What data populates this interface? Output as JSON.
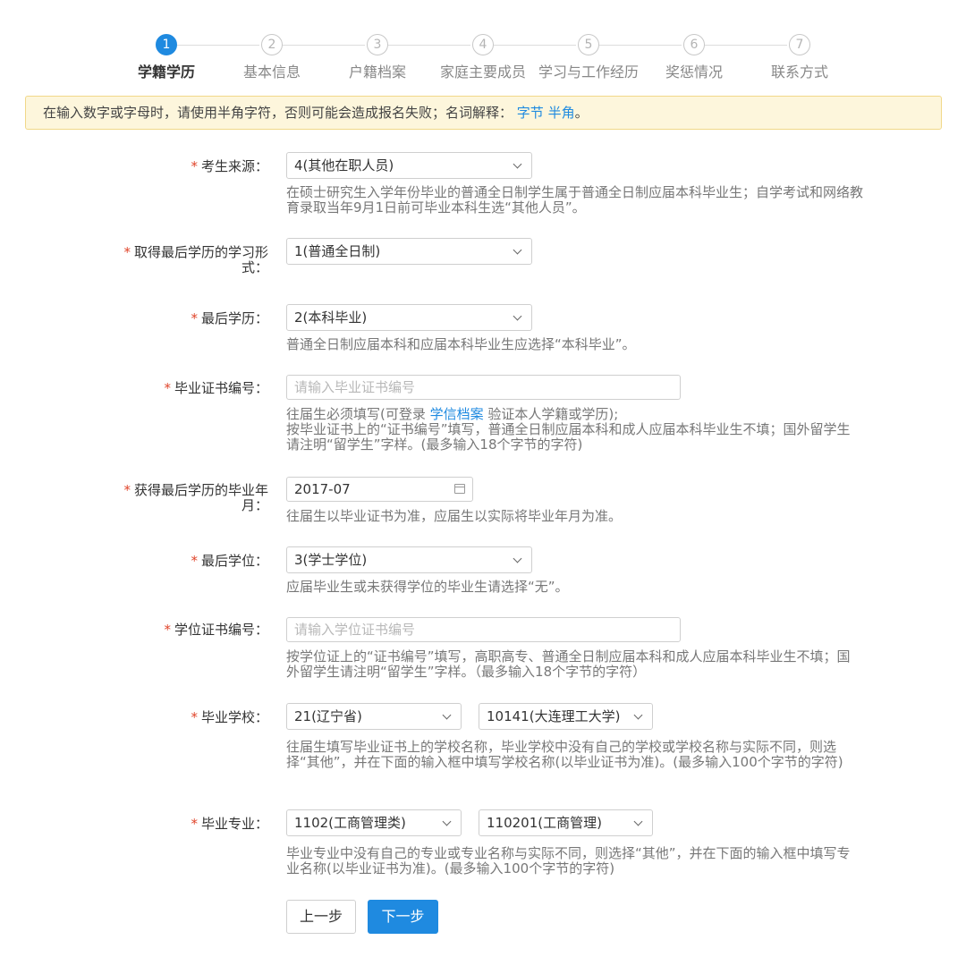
{
  "steps": [
    {
      "num": "1",
      "label": "学籍学历"
    },
    {
      "num": "2",
      "label": "基本信息"
    },
    {
      "num": "3",
      "label": "户籍档案"
    },
    {
      "num": "4",
      "label": "家庭主要成员"
    },
    {
      "num": "5",
      "label": "学习与工作经历"
    },
    {
      "num": "6",
      "label": "奖惩情况"
    },
    {
      "num": "7",
      "label": "联系方式"
    }
  ],
  "notice": {
    "text": "在输入数字或字母时，请使用半角字符，否则可能会造成报名失败；名词解释：",
    "link1": "字节",
    "link2": "半角",
    "end": "。"
  },
  "required_mark": "*",
  "fields": {
    "source": {
      "label": "考生来源：",
      "value": "4(其他在职人员)",
      "help": "在硕士研究生入学年份毕业的普通全日制学生属于普通全日制应届本科毕业生；自学考试和网络教育录取当年9月1日前可毕业本科生选“其他人员”。"
    },
    "study_form": {
      "label_line1": "取得最后学历的学习形",
      "label_line2": "式：",
      "value": "1(普通全日制)"
    },
    "education": {
      "label": "最后学历：",
      "value": "2(本科毕业)",
      "help": "普通全日制应届本科和应届本科毕业生应选择“本科毕业”。"
    },
    "diploma_no": {
      "label": "毕业证书编号：",
      "placeholder": "请输入毕业证书编号",
      "help_pre": "往届生必须填写(可登录 ",
      "help_link": "学信档案",
      "help_post": " 验证本人学籍或学历);",
      "help_line2": "按毕业证书上的“证书编号”填写，普通全日制应届本科和成人应届本科毕业生不填；国外留学生请注明“留学生”字样。(最多输入18个字节的字符)"
    },
    "grad_date": {
      "label_line1": "获得最后学历的毕业年",
      "label_line2": "月：",
      "value": "2017-07",
      "help": "往届生以毕业证书为准，应届生以实际将毕业年月为准。"
    },
    "degree": {
      "label": "最后学位：",
      "value": "3(学士学位)",
      "help": "应届毕业生或未获得学位的毕业生请选择“无”。"
    },
    "degree_no": {
      "label": "学位证书编号：",
      "placeholder": "请输入学位证书编号",
      "help": "按学位证上的“证书编号”填写，高职高专、普通全日制应届本科和成人应届本科毕业生不填；国外留学生请注明“留学生”字样。（最多输入18个字节的字符）"
    },
    "school": {
      "label": "毕业学校：",
      "province": "21(辽宁省)",
      "name": "10141(大连理工大学)",
      "help": "往届生填写毕业证书上的学校名称，毕业学校中没有自己的学校或学校名称与实际不同，则选择“其他”，并在下面的输入框中填写学校名称(以毕业证书为准)。(最多输入100个字节的字符)"
    },
    "major": {
      "label": "毕业专业：",
      "category": "1102(工商管理类)",
      "name": "110201(工商管理)",
      "help": "毕业专业中没有自己的专业或专业名称与实际不同，则选择“其他”，并在下面的输入框中填写专业名称(以毕业证书为准)。(最多输入100个字节的字符)"
    }
  },
  "buttons": {
    "prev": "上一步",
    "next": "下一步"
  },
  "colors": {
    "accent": "#1f8ae0",
    "required": "#e0452b",
    "notice_bg": "#fdf6dc",
    "notice_border": "#f1d889"
  }
}
